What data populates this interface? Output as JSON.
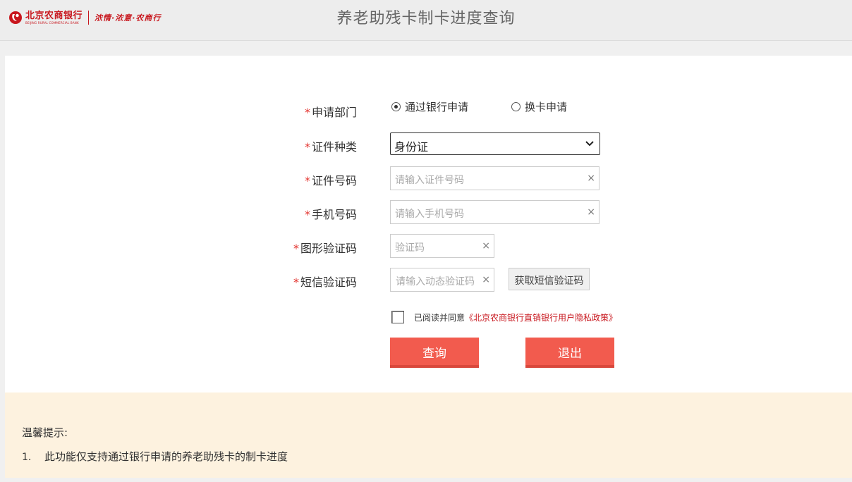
{
  "header": {
    "logo_cn": "北京农商银行",
    "logo_en": "BEIJING RURAL COMMERCIAL BANK",
    "slogan": "浓情·浓意·农商行",
    "title": "养老助残卡制卡进度查询"
  },
  "form": {
    "department": {
      "star": "*",
      "label": "申请部门",
      "options": [
        {
          "label": "通过银行申请",
          "checked": true
        },
        {
          "label": "换卡申请",
          "checked": false
        }
      ]
    },
    "id_type": {
      "star": "*",
      "label": "证件种类",
      "selected": "身份证"
    },
    "id_number": {
      "star": "*",
      "label": "证件号码",
      "placeholder": "请输入证件号码",
      "clear": "×"
    },
    "phone": {
      "star": "*",
      "label": "手机号码",
      "placeholder": "请输入手机号码",
      "clear": "×"
    },
    "captcha": {
      "star": "*",
      "label": "图形验证码",
      "placeholder": "验证码",
      "clear": "×"
    },
    "sms": {
      "star": "*",
      "label": "短信验证码",
      "placeholder": "请输入动态验证码",
      "clear": "×",
      "button": "获取短信验证码"
    },
    "agreement": {
      "text": "已阅读并同意",
      "link": "《北京农商银行直销银行用户隐私政策》",
      "checked": false
    },
    "query_button": "查询",
    "exit_button": "退出"
  },
  "tips": {
    "title": "温馨提示:",
    "items": [
      {
        "num": "1.",
        "text": "此功能仅支持通过银行申请的养老助残卡的制卡进度"
      }
    ]
  },
  "colors": {
    "brand": "#c8161d",
    "button": "#f25b4e",
    "tips_bg": "#fdf2df"
  }
}
